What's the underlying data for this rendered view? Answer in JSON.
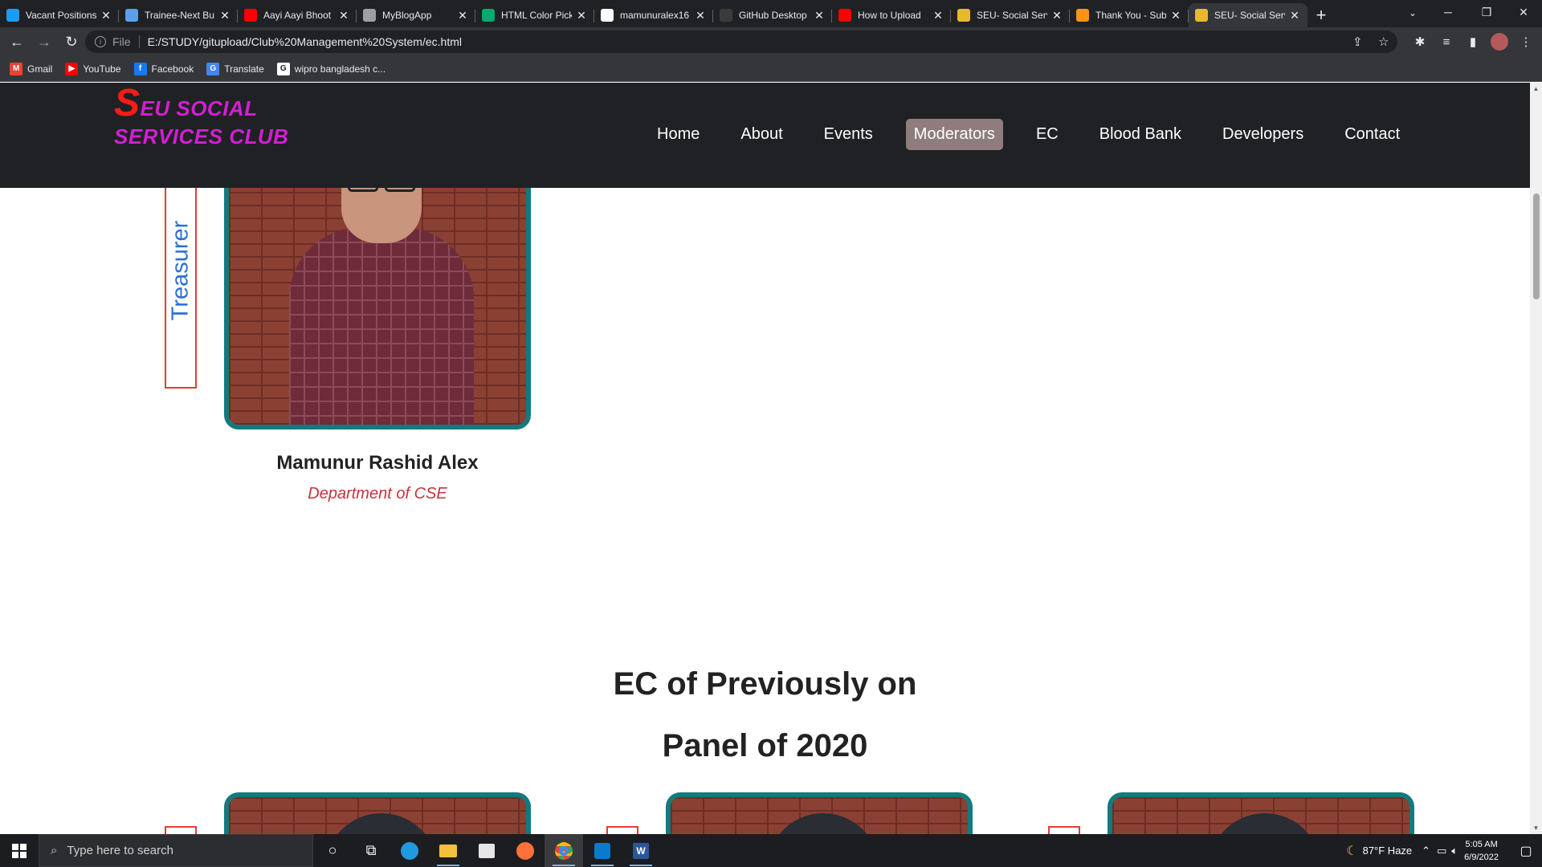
{
  "browser": {
    "tabs": [
      {
        "title": "Vacant Positions",
        "icon": "vacant-icon",
        "color": "#1d9bf0"
      },
      {
        "title": "Trainee-Next Bu",
        "icon": "trainee-icon",
        "color": "#5aa0e8"
      },
      {
        "title": "Aayi Aayi Bhoot",
        "icon": "youtube-icon",
        "color": "#ff0000"
      },
      {
        "title": "MyBlogApp",
        "icon": "globe-icon",
        "color": "#9aa0a6"
      },
      {
        "title": "HTML Color Pick",
        "icon": "w3schools-icon",
        "color": "#04aa6d"
      },
      {
        "title": "mamunuralex16",
        "icon": "github-icon",
        "color": "#ffffff"
      },
      {
        "title": "GitHub Desktop",
        "icon": "github-icon",
        "color": "#3b3b3b"
      },
      {
        "title": "How to Upload",
        "icon": "youtube-icon",
        "color": "#ff0000"
      },
      {
        "title": "SEU- Social Serv",
        "icon": "club-icon",
        "color": "#e8b830"
      },
      {
        "title": "Thank You - Sub",
        "icon": "thankyou-icon",
        "color": "#f7931a"
      },
      {
        "title": "SEU- Social Serv",
        "icon": "club-icon",
        "color": "#e8b830",
        "active": true
      }
    ],
    "new_tab": "+",
    "address": {
      "scheme": "File",
      "url": "E:/STUDY/gitupload/Club%20Management%20System/ec.html"
    },
    "bookmarks": [
      {
        "label": "Gmail",
        "icon": "gmail-icon",
        "color": "#ea4335",
        "glyph": "M"
      },
      {
        "label": "YouTube",
        "icon": "youtube-icon",
        "color": "#ff0000",
        "glyph": "▶"
      },
      {
        "label": "Facebook",
        "icon": "facebook-icon",
        "color": "#1877f2",
        "glyph": "f"
      },
      {
        "label": "Translate",
        "icon": "translate-icon",
        "color": "#4285f4",
        "glyph": "G"
      },
      {
        "label": "wipro bangladesh c...",
        "icon": "google-icon",
        "color": "#ffffff",
        "glyph": "G"
      }
    ]
  },
  "site": {
    "logo": {
      "big_letter": "S",
      "line1_rest": "EU SOCIAL",
      "line2": "SERVICES CLUB"
    },
    "nav": [
      "Home",
      "About",
      "Events",
      "Moderators",
      "EC",
      "Blood Bank",
      "Developers",
      "Contact"
    ],
    "nav_active": "Moderators",
    "treasurer": {
      "role": "Treasurer",
      "name": "Mamunur Rashid Alex",
      "department": "Department of CSE"
    },
    "section": {
      "line1": "EC of Previously on",
      "line2": "Panel of 2020"
    }
  },
  "taskbar": {
    "search_placeholder": "Type here to search",
    "weather": "87°F  Haze",
    "time": "5:05 AM",
    "date": "6/9/2022"
  }
}
